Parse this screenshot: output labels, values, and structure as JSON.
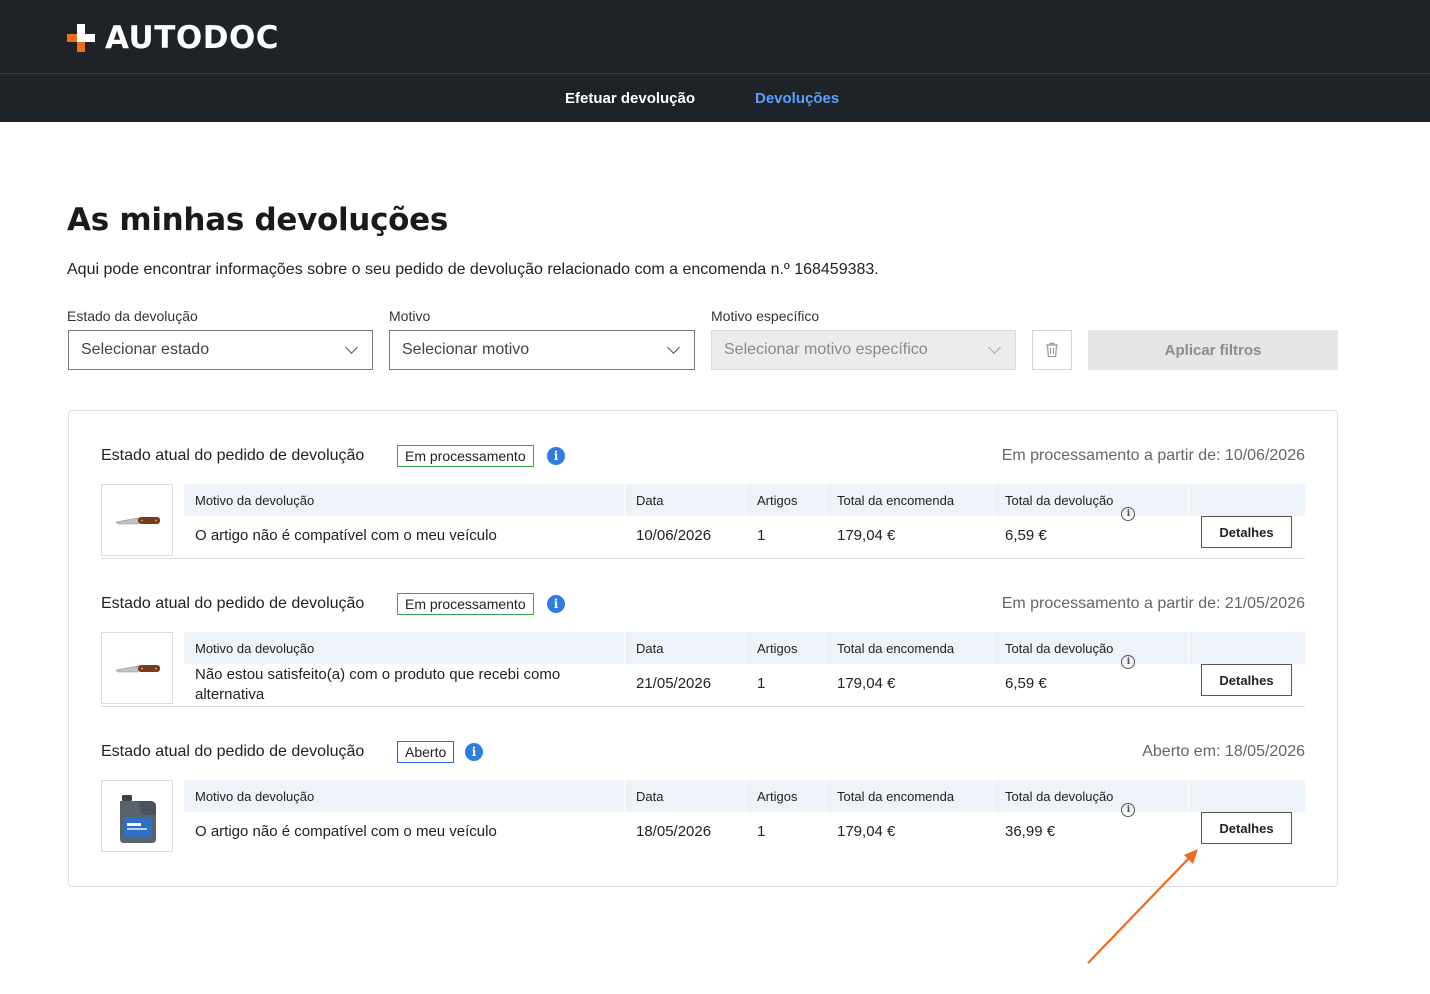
{
  "header": {
    "brand": "AUTODOC",
    "nav": [
      {
        "label": "Efetuar devolução",
        "active": false
      },
      {
        "label": "Devoluções",
        "active": true
      }
    ]
  },
  "main": {
    "title": "As minhas devoluções",
    "subtitle": "Aqui pode encontrar informações sobre o seu pedido de devolução relacionado com a encomenda n.º 168459383."
  },
  "filters": {
    "status": {
      "label": "Estado da devolução",
      "placeholder": "Selecionar estado"
    },
    "reason": {
      "label": "Motivo",
      "placeholder": "Selecionar motivo"
    },
    "specific_reason": {
      "label": "Motivo específico",
      "placeholder": "Selecionar motivo específico",
      "disabled": true
    },
    "apply_label": "Aplicar filtros"
  },
  "table_headers": {
    "reason": "Motivo da devolução",
    "date": "Data",
    "items": "Artigos",
    "order_total": "Total da encomenda",
    "return_total": "Total da devolução"
  },
  "returns": [
    {
      "state_label": "Estado atual do pedido de devolução",
      "status": "Em processamento",
      "status_color": "#3aa64a",
      "state_date": "Em processamento a partir de: 10/06/2026",
      "product_icon": "knife-icon",
      "reason": "O artigo não é compatível com o meu veículo",
      "date": "10/06/2026",
      "items": "1",
      "order_total": "179,04 €",
      "return_total": "6,59 €",
      "details_label": "Detalhes"
    },
    {
      "state_label": "Estado atual do pedido de devolução",
      "status": "Em processamento",
      "status_color": "#3aa64a",
      "state_date": "Em processamento a partir de: 21/05/2026",
      "product_icon": "knife-icon",
      "reason": "Não estou satisfeito(a) com o produto que recebi como alternativa",
      "date": "21/05/2026",
      "items": "1",
      "order_total": "179,04 €",
      "return_total": "6,59 €",
      "details_label": "Detalhes"
    },
    {
      "state_label": "Estado atual do pedido de devolução",
      "status": "Aberto",
      "status_color": "#2c6cd1",
      "state_date": "Aberto em: 18/05/2026",
      "product_icon": "oil-canister-icon",
      "reason": "O artigo não é compatível com o meu veículo",
      "date": "18/05/2026",
      "items": "1",
      "order_total": "179,04 €",
      "return_total": "36,99 €",
      "details_label": "Detalhes"
    }
  ],
  "annotation": {
    "arrow_color": "#f26a1b",
    "target": "details-button-3"
  }
}
